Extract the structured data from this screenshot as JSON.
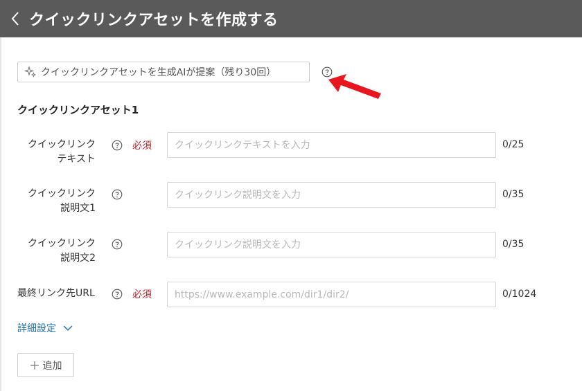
{
  "header": {
    "title": "クイックリンクアセットを作成する"
  },
  "ai_suggest": {
    "label": "クイックリンクアセットを生成AIが提案（残り30回）"
  },
  "section": {
    "title": "クイックリンクアセット1"
  },
  "fields": [
    {
      "label_line1": "クイックリンク",
      "label_line2": "テキスト",
      "required": "必須",
      "placeholder": "クイックリンクテキストを入力",
      "counter": "0/25"
    },
    {
      "label_line1": "クイックリンク",
      "label_line2": "説明文1",
      "required": "",
      "placeholder": "クイックリンク説明文を入力",
      "counter": "0/35"
    },
    {
      "label_line1": "クイックリンク",
      "label_line2": "説明文2",
      "required": "",
      "placeholder": "クイックリンク説明文を入力",
      "counter": "0/35"
    },
    {
      "label_line1": "最終リンク先URL",
      "label_line2": "",
      "required": "必須",
      "placeholder": "https://www.example.com/dir1/dir2/",
      "counter": "0/1024"
    }
  ],
  "details": {
    "label": "詳細設定"
  },
  "add_button": {
    "label": "追加"
  },
  "colors": {
    "header_bg": "#5a5a5a",
    "required": "#c7242b",
    "link": "#1a6fb5",
    "arrow": "#e8161e"
  }
}
